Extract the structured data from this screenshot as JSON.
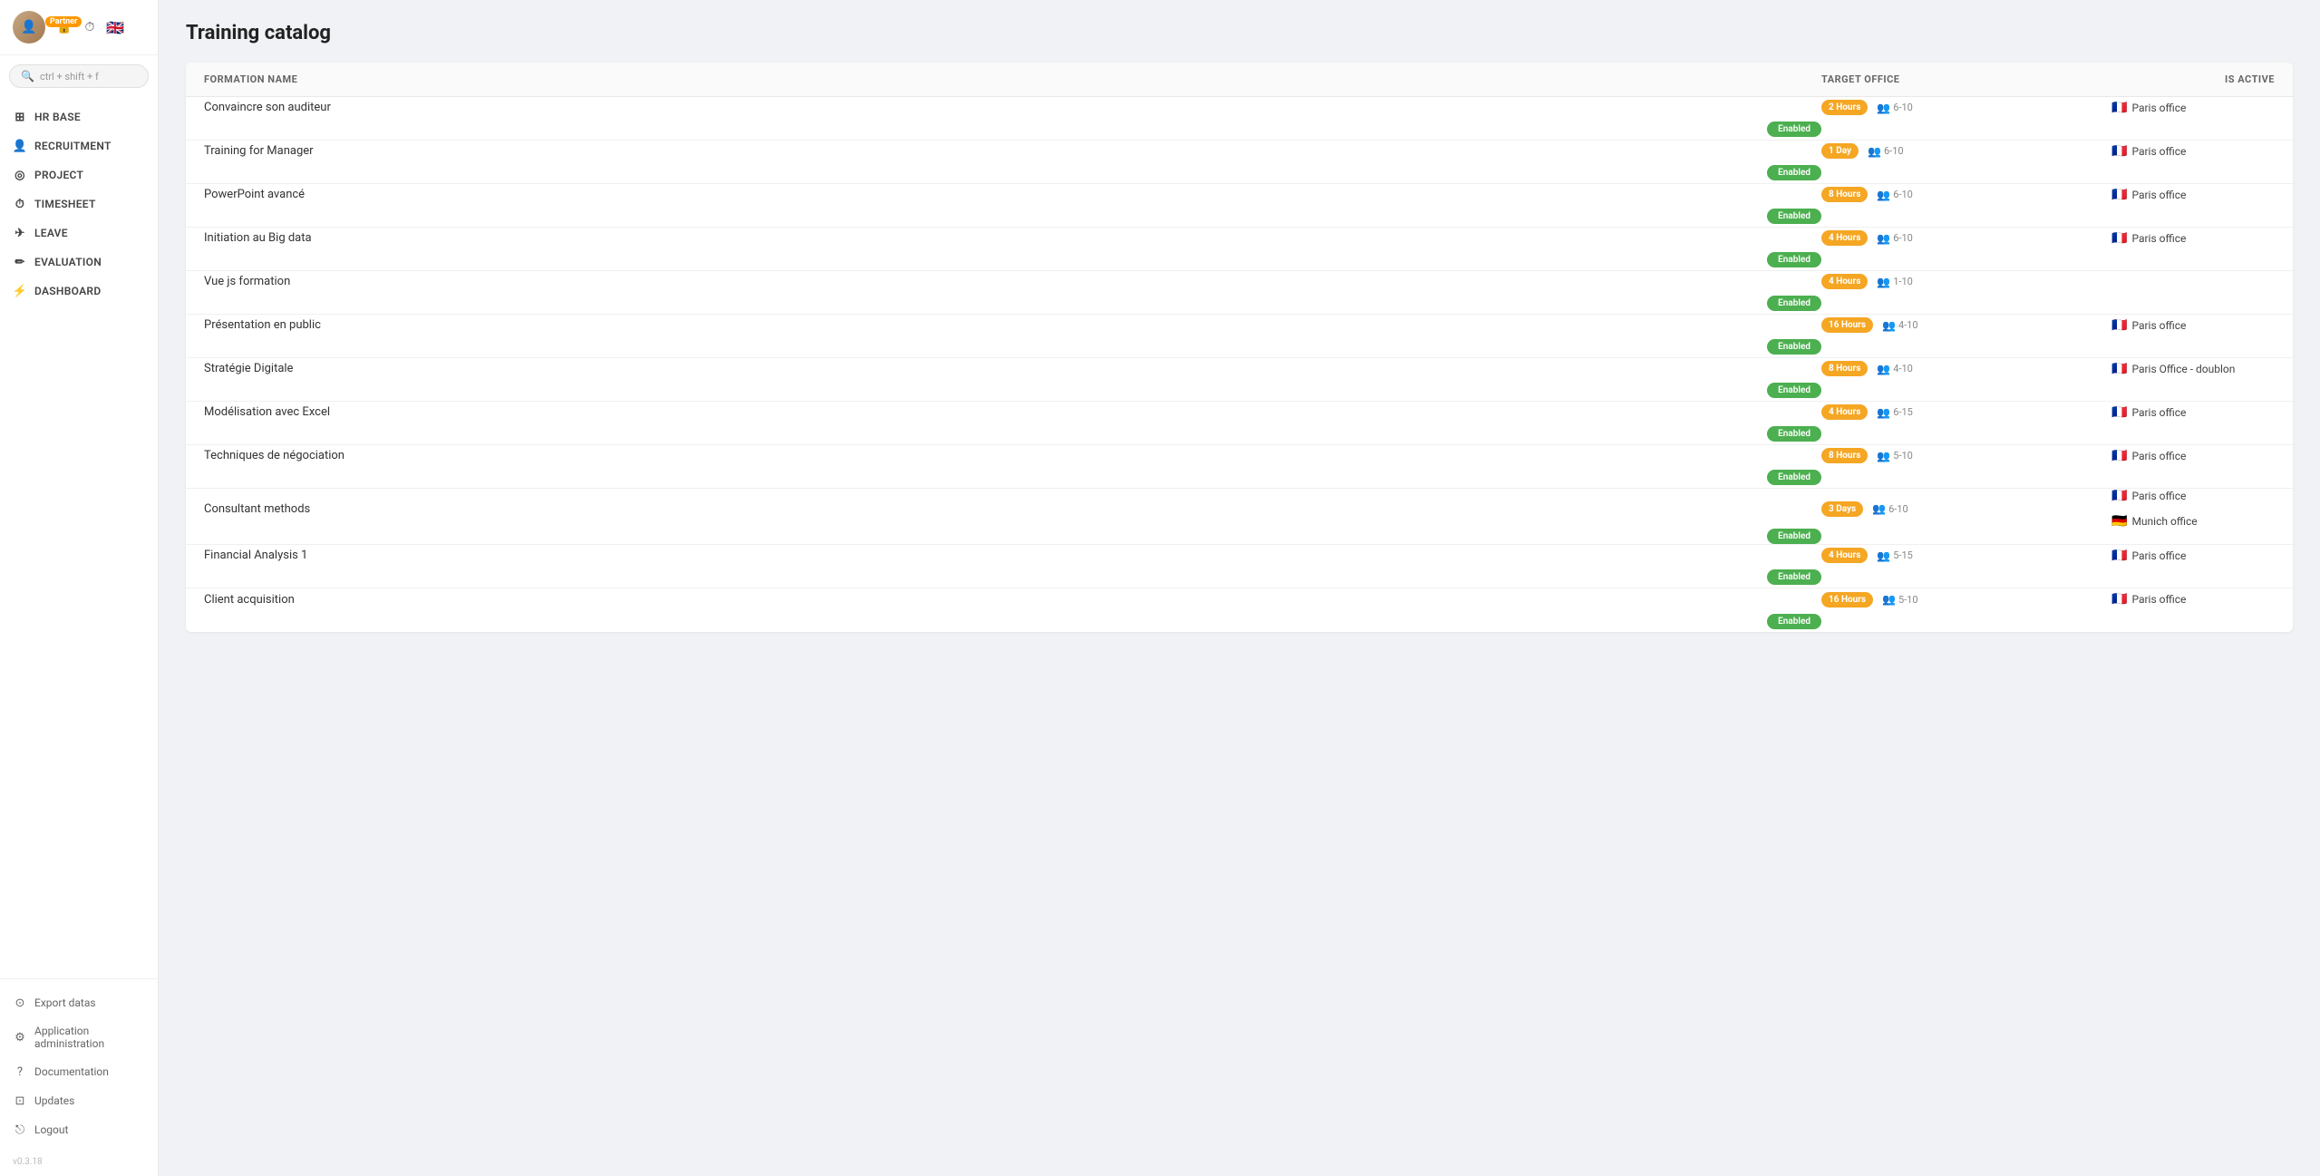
{
  "app": {
    "version": "v0.3.18"
  },
  "header": {
    "partner_badge": "Partner",
    "search_placeholder": "ctrl + shift + f"
  },
  "sidebar": {
    "nav_items": [
      {
        "id": "hr-base",
        "label": "HR BASE",
        "icon": "⊞"
      },
      {
        "id": "recruitment",
        "label": "RECRUITMENT",
        "icon": "👤"
      },
      {
        "id": "project",
        "label": "PROJECT",
        "icon": "◎"
      },
      {
        "id": "timesheet",
        "label": "TIMESHEET",
        "icon": "⏱"
      },
      {
        "id": "leave",
        "label": "LEAVE",
        "icon": "✈"
      },
      {
        "id": "evaluation",
        "label": "EVALUATION",
        "icon": "✏"
      },
      {
        "id": "dashboard",
        "label": "DASHBOARD",
        "icon": "⚡"
      }
    ],
    "utility_items": [
      {
        "id": "export-datas",
        "label": "Export datas",
        "icon": "⊙"
      },
      {
        "id": "app-admin",
        "label": "Application administration",
        "icon": "⚙"
      },
      {
        "id": "documentation",
        "label": "Documentation",
        "icon": "?"
      },
      {
        "id": "updates",
        "label": "Updates",
        "icon": "⊡"
      },
      {
        "id": "logout",
        "label": "Logout",
        "icon": "⎋"
      }
    ]
  },
  "page": {
    "title": "Training catalog"
  },
  "table": {
    "columns": [
      "FORMATION NAME",
      "TARGET OFFICE",
      "IS ACTIVE"
    ],
    "rows": [
      {
        "name": "Convaincre son auditeur",
        "duration": "2 Hours",
        "group": "6-10",
        "offices": [
          {
            "flag": "🇫🇷",
            "name": "Paris office"
          }
        ],
        "status": "Enabled"
      },
      {
        "name": "Training for Manager",
        "duration": "1 Day",
        "group": "6-10",
        "offices": [
          {
            "flag": "🇫🇷",
            "name": "Paris office"
          }
        ],
        "status": "Enabled"
      },
      {
        "name": "PowerPoint avancé",
        "duration": "8 Hours",
        "group": "6-10",
        "offices": [
          {
            "flag": "🇫🇷",
            "name": "Paris office"
          }
        ],
        "status": "Enabled"
      },
      {
        "name": "Initiation au Big data",
        "duration": "4 Hours",
        "group": "6-10",
        "offices": [
          {
            "flag": "🇫🇷",
            "name": "Paris office"
          }
        ],
        "status": "Enabled"
      },
      {
        "name": "Vue js formation",
        "duration": "4 Hours",
        "group": "1-10",
        "offices": [],
        "status": "Enabled"
      },
      {
        "name": "Présentation en public",
        "duration": "16 Hours",
        "group": "4-10",
        "offices": [
          {
            "flag": "🇫🇷",
            "name": "Paris office"
          }
        ],
        "status": "Enabled"
      },
      {
        "name": "Stratégie Digitale",
        "duration": "8 Hours",
        "group": "4-10",
        "offices": [
          {
            "flag": "🇫🇷",
            "name": "Paris Office - doublon"
          }
        ],
        "status": "Enabled"
      },
      {
        "name": "Modélisation avec Excel",
        "duration": "4 Hours",
        "group": "6-15",
        "offices": [
          {
            "flag": "🇫🇷",
            "name": "Paris office"
          }
        ],
        "status": "Enabled"
      },
      {
        "name": "Techniques de négociation",
        "duration": "8 Hours",
        "group": "5-10",
        "offices": [
          {
            "flag": "🇫🇷",
            "name": "Paris office"
          }
        ],
        "status": "Enabled"
      },
      {
        "name": "Consultant methods",
        "duration": "3 Days",
        "group": "6-10",
        "offices": [
          {
            "flag": "🇫🇷",
            "name": "Paris office"
          },
          {
            "flag": "🇩🇪",
            "name": "Munich office"
          }
        ],
        "status": "Enabled"
      },
      {
        "name": "Financial Analysis 1",
        "duration": "4 Hours",
        "group": "5-15",
        "offices": [
          {
            "flag": "🇫🇷",
            "name": "Paris office"
          }
        ],
        "status": "Enabled"
      },
      {
        "name": "Client acquisition",
        "duration": "16 Hours",
        "group": "5-10",
        "offices": [
          {
            "flag": "🇫🇷",
            "name": "Paris office"
          }
        ],
        "status": "Enabled"
      }
    ]
  }
}
